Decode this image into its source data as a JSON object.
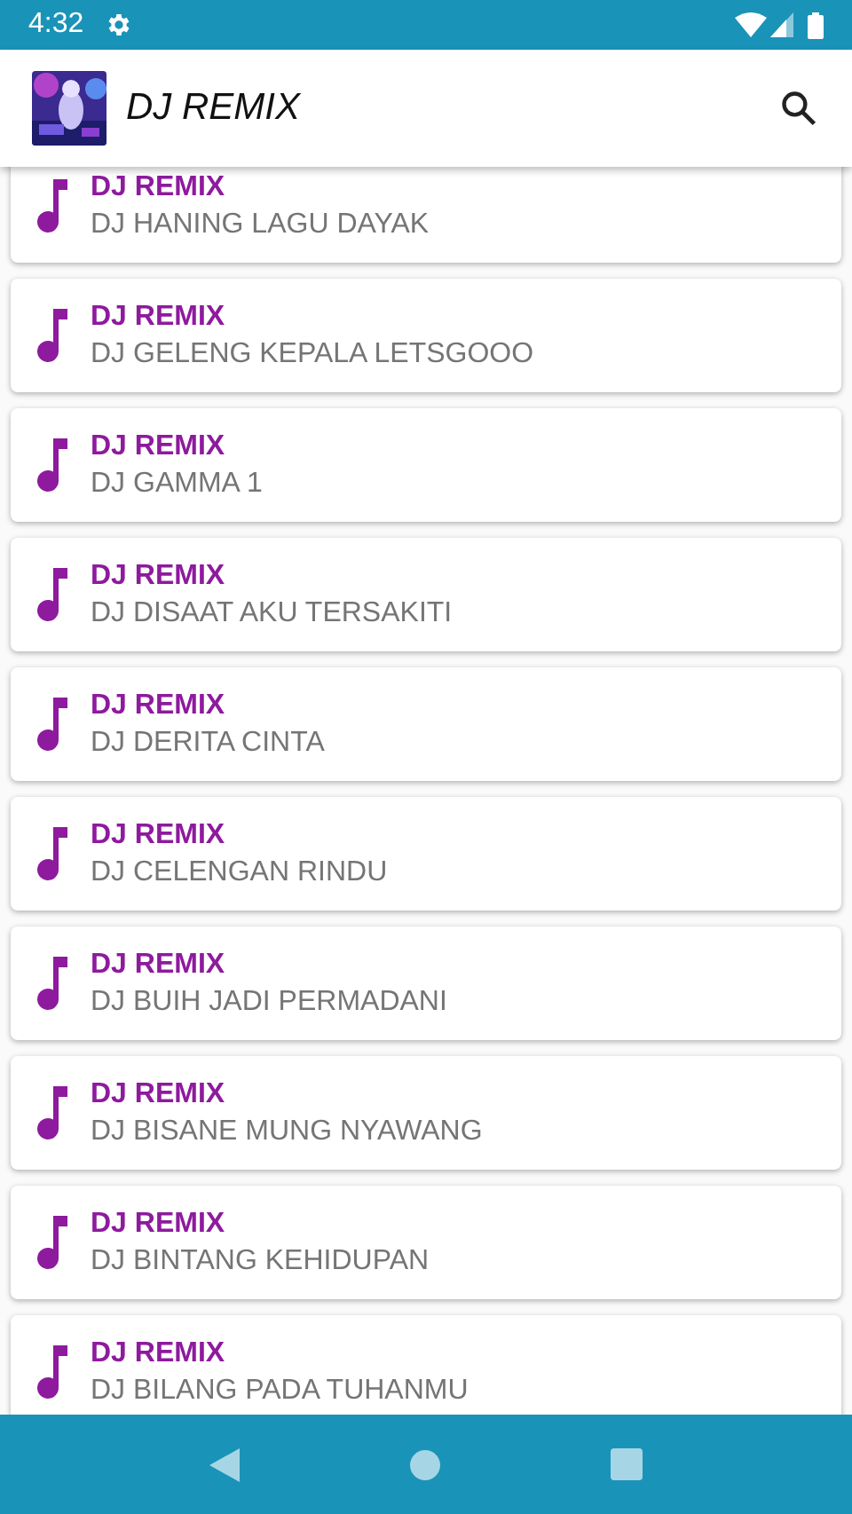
{
  "status_bar": {
    "time": "4:32"
  },
  "app_bar": {
    "title": "DJ REMIX"
  },
  "songs": [
    {
      "title": "DJ REMIX",
      "name": "DJ HANING LAGU DAYAK"
    },
    {
      "title": "DJ REMIX",
      "name": "DJ GELENG KEPALA LETSGOOO"
    },
    {
      "title": "DJ REMIX",
      "name": "DJ GAMMA 1"
    },
    {
      "title": "DJ REMIX",
      "name": "DJ DISAAT AKU TERSAKITI"
    },
    {
      "title": "DJ REMIX",
      "name": "DJ DERITA CINTA"
    },
    {
      "title": "DJ REMIX",
      "name": "DJ CELENGAN RINDU"
    },
    {
      "title": "DJ REMIX",
      "name": "DJ BUIH JADI PERMADANI"
    },
    {
      "title": "DJ REMIX",
      "name": "DJ BISANE MUNG NYAWANG"
    },
    {
      "title": "DJ REMIX",
      "name": "DJ BINTANG KEHIDUPAN"
    },
    {
      "title": "DJ REMIX",
      "name": "DJ BILANG PADA TUHANMU"
    }
  ]
}
